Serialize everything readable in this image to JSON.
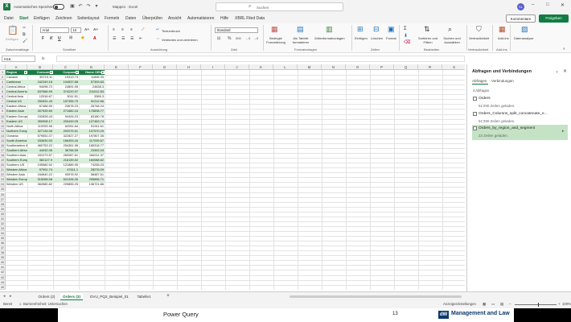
{
  "titlebar": {
    "autosave_label": "Automatisches Speichern",
    "doc_title": "Mappe1 · Excel",
    "search_placeholder": "Suchen",
    "avatar_initials": "SL"
  },
  "menu": {
    "tabs": [
      "Datei",
      "Start",
      "Einfügen",
      "Zeichnen",
      "Seitenlayout",
      "Formeln",
      "Daten",
      "Überprüfen",
      "Ansicht",
      "Automatisieren",
      "Hilfe",
      "XBRL Filed Data"
    ],
    "active_index": 1,
    "comments_label": "Kommentare",
    "share_label": "Freigeben"
  },
  "ribbon": {
    "clipboard": {
      "paste": "Einfügen",
      "group": "Zwischenablage"
    },
    "font": {
      "name": "Arial",
      "size": "10",
      "group": "Schriftart"
    },
    "alignment": {
      "wrap": "Textumbruch",
      "merge": "Verbinden und zentrieren",
      "group": "Ausrichtung"
    },
    "number": {
      "format": "Standard",
      "group": "Zahl"
    },
    "styles": {
      "conditional": "Bedingte Formatierung",
      "as_table": "Als Tabelle formatieren",
      "cell_styles": "Zellenformatvorlagen",
      "group": "Formatvorlagen"
    },
    "cells": {
      "insert": "Einfügen",
      "delete": "Löschen",
      "format": "Format",
      "group": "Zellen"
    },
    "editing": {
      "sort": "Sortieren und Filtern",
      "find": "Suchen und Auswählen",
      "group": "Bearbeiten"
    },
    "sensitivity": {
      "label": "Vertraulichkeit",
      "group": "Vertraulichkeit"
    },
    "addins": {
      "label": "Add-ins",
      "group": "Add-ins"
    },
    "analysis": {
      "label": "Datenanalyse"
    }
  },
  "formula_bar": {
    "name_box": "H16",
    "fx": "fx",
    "value": ""
  },
  "columns": [
    "A",
    "B",
    "C",
    "D",
    "E",
    "F",
    "G",
    "H",
    "I",
    "J",
    "K",
    "L",
    "M",
    "N",
    "O",
    "P",
    "Q",
    "R",
    "S"
  ],
  "table": {
    "headers": [
      "Region",
      "Consumer",
      "Corporate",
      "Home Office"
    ],
    "rows": [
      [
        "Canada",
        "35719.11",
        "19313.73",
        "11895.33"
      ],
      [
        "Caribbean",
        "162349.18",
        "104537.88",
        "57393.83"
      ],
      [
        "Central Africa",
        "94096.72",
        "24891.95",
        "24638.3"
      ],
      [
        "Central America",
        "637666.99",
        "374220.97",
        "211012.83"
      ],
      [
        "Central Asia",
        "12916.67",
        "3011.51",
        "3389.3"
      ],
      [
        "Central US",
        "252631.43",
        "157395.79",
        "91212.66"
      ],
      [
        "Eastern Africa",
        "67486.59",
        "23678.23",
        "26748.24"
      ],
      [
        "Eastern Asia",
        "407539.69",
        "271682.16",
        "175838.77"
      ],
      [
        "Eastern Europe",
        "152828.43",
        "94426.23",
        "63180.78"
      ],
      [
        "Eastern US",
        "350908.17",
        "200449.05",
        "127463.74"
      ],
      [
        "North Africa",
        "119253.96",
        "62051.84",
        "51911.61"
      ],
      [
        "Northern Europe",
        "327134.05",
        "202075.61",
        "107570.29"
      ],
      [
        "Oceania",
        "579551.07",
        "322827.27",
        "197807.35"
      ],
      [
        "South America",
        "333630.93",
        "166493.44",
        "117099.67"
      ],
      [
        "Southeastern Asia",
        "460753.22",
        "254361.96",
        "165318.77"
      ],
      [
        "Southern Africa",
        "44932.06",
        "36766.59",
        "23392.03"
      ],
      [
        "Southern Asia",
        "431073.57",
        "260087.61",
        "166211.37"
      ],
      [
        "Southern Europe",
        "382127.9",
        "216159.52",
        "160088.62"
      ],
      [
        "Southern US",
        "195580.92",
        "121885.95",
        "74255.03"
      ],
      [
        "Western Africa",
        "97991.74",
        "47611.1",
        "28276.09"
      ],
      [
        "Western Asia",
        "164640.22",
        "93978.92",
        "58487.61"
      ],
      [
        "Western Europe",
        "915068.08",
        "521206.26",
        "295656.71"
      ],
      [
        "Western US",
        "362880.82",
        "225855.25",
        "136721.86"
      ]
    ]
  },
  "pane": {
    "title": "Abfragen und Verbindungen",
    "tabs": [
      "Abfragen",
      "Verbindungen"
    ],
    "count": "3 Abfragen",
    "queries": [
      {
        "name": "Orders",
        "status": "51'290 Zeilen geladen."
      },
      {
        "name": "Orders_Columns_split_concatenate_e...",
        "status": "51'290 Zeilen geladen."
      },
      {
        "name": "Orders_by_region_and_segment",
        "status": "23 Zeilen geladen."
      }
    ]
  },
  "sheets": {
    "tabs": [
      "Orders (2)",
      "Orders (3)",
      "DVU_PQ2_Beispiel_01",
      "Tabelle1"
    ],
    "active_index": 1,
    "add_label": "+"
  },
  "statusbar": {
    "ready": "Bereit",
    "accessibility": "Barrierefreiheit: Untersuchen",
    "display_settings": "Anzeigeeinstellungen",
    "zoom": "100%",
    "zoom_level": 0.55
  },
  "footer": {
    "title": "Power Query",
    "page": "13",
    "brand_logo": "dW",
    "brand": "Management and Law"
  }
}
